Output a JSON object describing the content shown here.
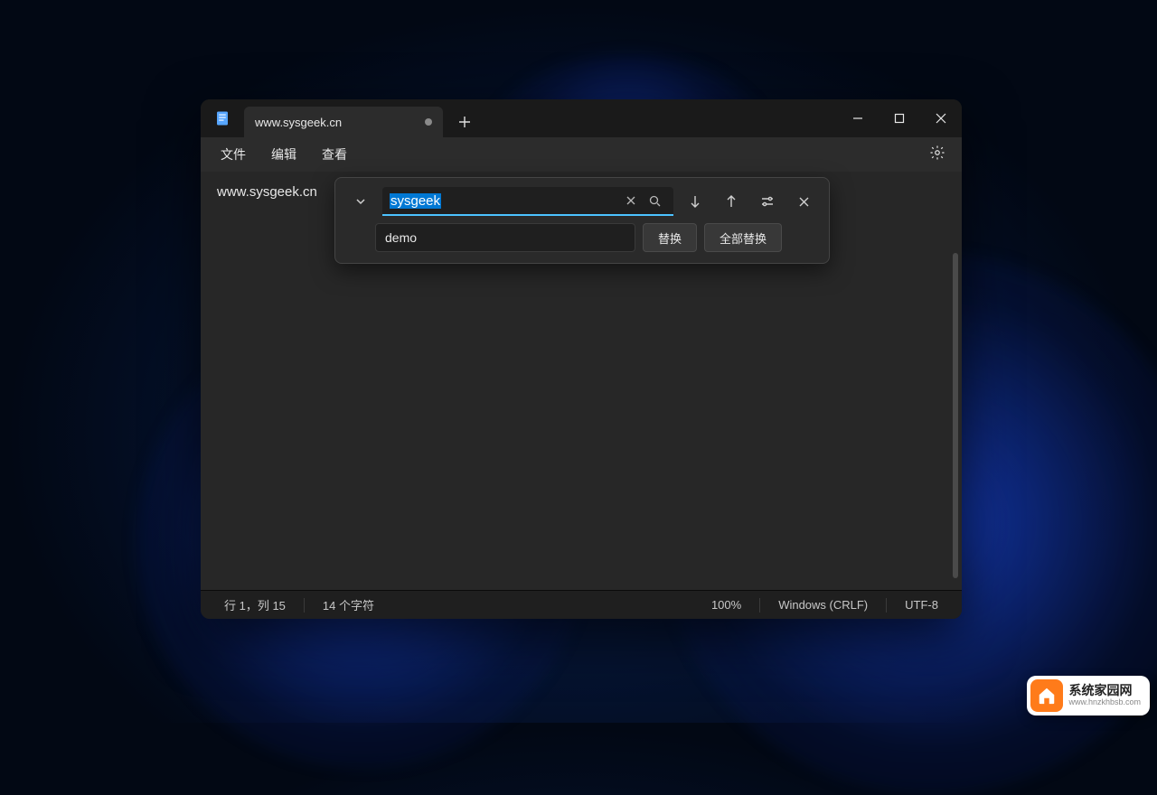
{
  "window": {
    "tab_title": "www.sysgeek.cn",
    "tab_modified": true
  },
  "menu": {
    "file": "文件",
    "edit": "编辑",
    "view": "查看"
  },
  "editor": {
    "content": "www.sysgeek.cn"
  },
  "find_replace": {
    "search_value": "sysgeek",
    "replace_value": "demo",
    "replace_button": "替换",
    "replace_all_button": "全部替换"
  },
  "statusbar": {
    "position": "行 1，列 15",
    "chars": "14 个字符",
    "zoom": "100%",
    "line_ending": "Windows (CRLF)",
    "encoding": "UTF-8"
  },
  "watermark": {
    "title": "系统家园网",
    "url": "www.hnzkhbsb.com"
  }
}
